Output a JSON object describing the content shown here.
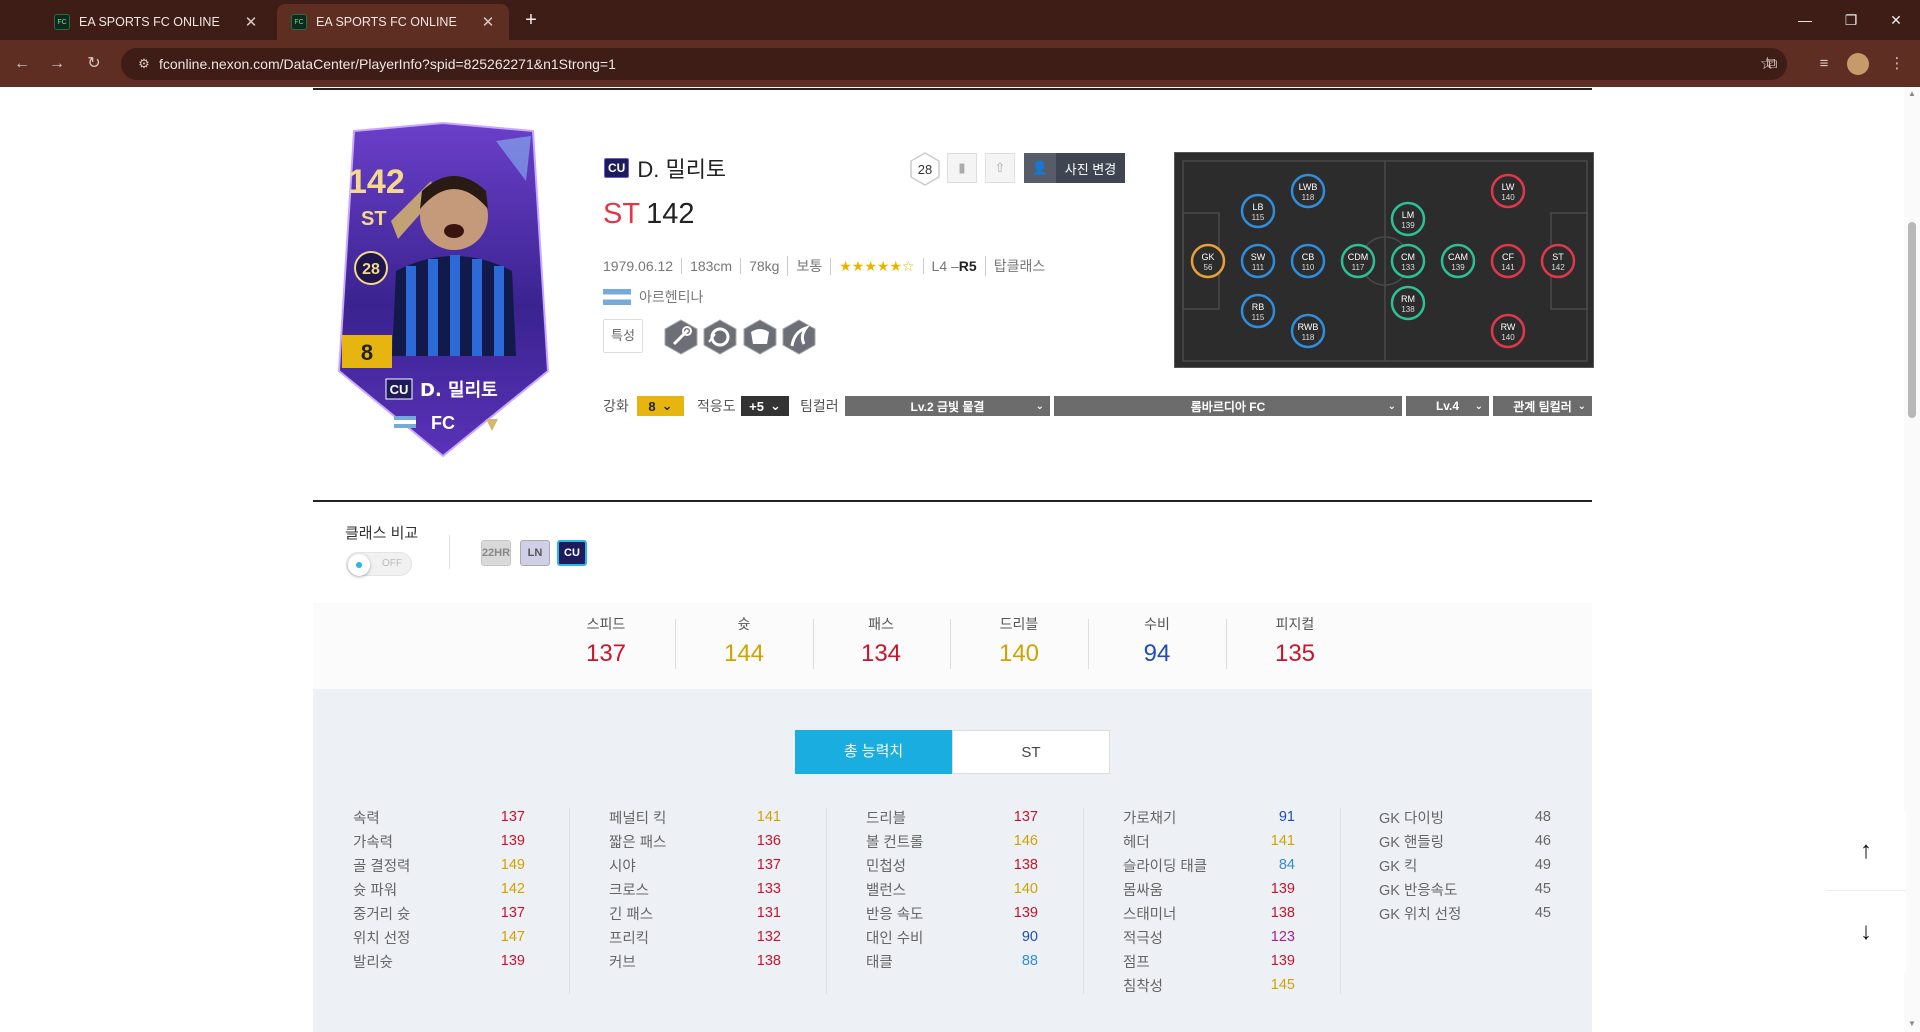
{
  "browser": {
    "tabs": [
      {
        "title": "EA SPORTS FC ONLINE",
        "active": false
      },
      {
        "title": "EA SPORTS FC ONLINE",
        "active": true
      }
    ],
    "url": "fconline.nexon.com/DataCenter/PlayerInfo?spid=825262271&n1Strong=1"
  },
  "player": {
    "class_badge": "CU",
    "name": "D. 밀리토",
    "position": "ST",
    "ovr": "142",
    "birth": "1979.06.12",
    "height": "183cm",
    "weight": "78kg",
    "body": "보통",
    "stars": "★★★★★☆",
    "foot_left": "L4 –",
    "foot_right": "R5",
    "team_class": "탑클래스",
    "nation": "아르헨티나",
    "traits_label": "특성",
    "traits": [
      "trait-icon-1",
      "trait-icon-2",
      "trait-icon-3",
      "trait-icon-4"
    ],
    "season_level": "28",
    "photo_button": "사진 변경",
    "card": {
      "ovr": "142",
      "pos": "ST",
      "level": "28",
      "upgrade": "8",
      "class": "CU",
      "name": "D. 밀리토"
    }
  },
  "controls": {
    "enhance_label": "강화",
    "enhance_value": "8",
    "adapt_label": "적응도",
    "adapt_value": "+5",
    "teamcolor_label": "팀컬러",
    "teamcolor_select": "Lv.2 금빛 물결",
    "club_select": "롬바르디아 FC",
    "level_select": "Lv.4",
    "relation_select": "관계 팀컬러"
  },
  "class_compare": {
    "label": "클래스 비교",
    "toggle": "OFF",
    "classes": [
      "22HR",
      "LN",
      "CU"
    ]
  },
  "summary_stats": [
    {
      "label": "스피드",
      "value": "137",
      "color": "#c8152b"
    },
    {
      "label": "슛",
      "value": "144",
      "color": "#d1a300"
    },
    {
      "label": "패스",
      "value": "134",
      "color": "#c8152b"
    },
    {
      "label": "드리블",
      "value": "140",
      "color": "#d1a300"
    },
    {
      "label": "수비",
      "value": "94",
      "color": "#1d4db5"
    },
    {
      "label": "피지컬",
      "value": "135",
      "color": "#c8152b"
    }
  ],
  "tabs": {
    "total": "총 능력치",
    "pos": "ST"
  },
  "detail_stats": [
    [
      {
        "n": "속력",
        "v": "137",
        "c": "r"
      },
      {
        "n": "가속력",
        "v": "139",
        "c": "r"
      },
      {
        "n": "골 결정력",
        "v": "149",
        "c": "g"
      },
      {
        "n": "슛 파워",
        "v": "142",
        "c": "g"
      },
      {
        "n": "중거리 슛",
        "v": "137",
        "c": "r"
      },
      {
        "n": "위치 선정",
        "v": "147",
        "c": "g"
      },
      {
        "n": "발리슛",
        "v": "139",
        "c": "r"
      }
    ],
    [
      {
        "n": "페널티 킥",
        "v": "141",
        "c": "g"
      },
      {
        "n": "짧은 패스",
        "v": "136",
        "c": "r"
      },
      {
        "n": "시야",
        "v": "137",
        "c": "r"
      },
      {
        "n": "크로스",
        "v": "133",
        "c": "r"
      },
      {
        "n": "긴 패스",
        "v": "131",
        "c": "r"
      },
      {
        "n": "프리킥",
        "v": "132",
        "c": "r"
      },
      {
        "n": "커브",
        "v": "138",
        "c": "r"
      }
    ],
    [
      {
        "n": "드리블",
        "v": "137",
        "c": "r"
      },
      {
        "n": "볼 컨트롤",
        "v": "146",
        "c": "g"
      },
      {
        "n": "민첩성",
        "v": "138",
        "c": "r"
      },
      {
        "n": "밸런스",
        "v": "140",
        "c": "g"
      },
      {
        "n": "반응 속도",
        "v": "139",
        "c": "r"
      },
      {
        "n": "대인 수비",
        "v": "90",
        "c": "b"
      },
      {
        "n": "태클",
        "v": "88",
        "c": "lb"
      }
    ],
    [
      {
        "n": "가로채기",
        "v": "91",
        "c": "b"
      },
      {
        "n": "헤더",
        "v": "141",
        "c": "g"
      },
      {
        "n": "슬라이딩 태클",
        "v": "84",
        "c": "lb"
      },
      {
        "n": "몸싸움",
        "v": "139",
        "c": "r"
      },
      {
        "n": "스태미너",
        "v": "138",
        "c": "r"
      },
      {
        "n": "적극성",
        "v": "123",
        "c": "p"
      },
      {
        "n": "점프",
        "v": "139",
        "c": "r"
      },
      {
        "n": "침착성",
        "v": "145",
        "c": "g"
      }
    ],
    [
      {
        "n": "GK 다이빙",
        "v": "48",
        "c": "gr"
      },
      {
        "n": "GK 핸들링",
        "v": "46",
        "c": "gr"
      },
      {
        "n": "GK 킥",
        "v": "49",
        "c": "gr"
      },
      {
        "n": "GK 반응속도",
        "v": "45",
        "c": "gr"
      },
      {
        "n": "GK 위치 선정",
        "v": "45",
        "c": "gr"
      }
    ]
  ],
  "positions": [
    {
      "pos": "GK",
      "ovr": "56",
      "ring": "#e8a03a"
    },
    {
      "pos": "SW",
      "ovr": "111",
      "ring": "#2f8ddb"
    },
    {
      "pos": "LB",
      "ovr": "115",
      "ring": "#2f8ddb"
    },
    {
      "pos": "RB",
      "ovr": "115",
      "ring": "#2f8ddb"
    },
    {
      "pos": "CB",
      "ovr": "110",
      "ring": "#2f8ddb"
    },
    {
      "pos": "LWB",
      "ovr": "118",
      "ring": "#2f8ddb"
    },
    {
      "pos": "RWB",
      "ovr": "118",
      "ring": "#2f8ddb"
    },
    {
      "pos": "CDM",
      "ovr": "117",
      "ring": "#2fbf95"
    },
    {
      "pos": "LM",
      "ovr": "139",
      "ring": "#2fbf95"
    },
    {
      "pos": "CM",
      "ovr": "133",
      "ring": "#2fbf95"
    },
    {
      "pos": "RM",
      "ovr": "138",
      "ring": "#2fbf95"
    },
    {
      "pos": "CAM",
      "ovr": "139",
      "ring": "#2fbf95"
    },
    {
      "pos": "LW",
      "ovr": "140",
      "ring": "#e0384b"
    },
    {
      "pos": "CF",
      "ovr": "141",
      "ring": "#e0384b"
    },
    {
      "pos": "RW",
      "ovr": "140",
      "ring": "#e0384b"
    },
    {
      "pos": "ST",
      "ovr": "142",
      "ring": "#e0384b"
    }
  ],
  "scroll_buttons": {
    "up": "↑",
    "down": "↓"
  }
}
